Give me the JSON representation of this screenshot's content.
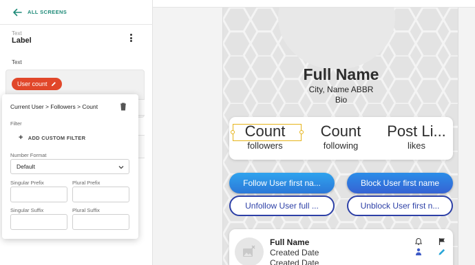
{
  "nav": {
    "back_label": "ALL SCREENS"
  },
  "property": {
    "type_label": "Text",
    "name": "Label",
    "text_section_label": "Text"
  },
  "chip": {
    "label": "User count"
  },
  "popup": {
    "title": "Current User > Followers > Count",
    "filter_label": "Filter",
    "add_filter_label": "ADD CUSTOM FILTER",
    "number_format_label": "Number Format",
    "number_format_value": "Default",
    "singular_prefix_label": "Singular Prefix",
    "plural_prefix_label": "Plural Prefix",
    "singular_suffix_label": "Singular Suffix",
    "plural_suffix_label": "Plural Suffix"
  },
  "profile": {
    "full_name": "Full Name",
    "city": "City, Name ABBR",
    "bio": "Bio",
    "stats": [
      {
        "value": "Count",
        "label": "followers"
      },
      {
        "value": "Count",
        "label": "following"
      },
      {
        "value": "Post Li...",
        "label": "likes"
      }
    ],
    "buttons": {
      "follow": "Follow User first na...",
      "block": "Block User first name",
      "unfollow": "Unfollow User full ...",
      "unblock": "Unblock User first n..."
    }
  },
  "notification": {
    "name": "Full Name",
    "date1": "Created Date",
    "date2": "Created Date"
  },
  "colors": {
    "accent_teal": "#1e8a78",
    "chip_red": "#e1472a",
    "selection_yellow": "#e5b319",
    "button_blue": "#2c78d8",
    "outline_navy": "#2c3fa6"
  }
}
